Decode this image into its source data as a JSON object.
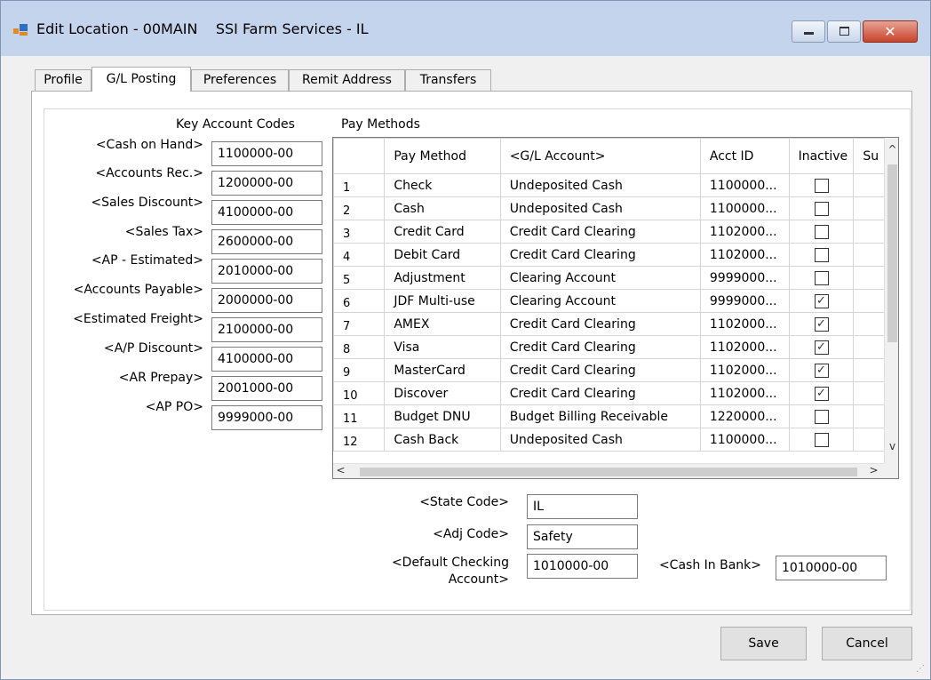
{
  "window": {
    "title": "Edit Location - 00MAIN    SSI Farm Services - IL",
    "minimize_glyph": "▭",
    "maximize_glyph": "▢",
    "close_glyph": "✕"
  },
  "tabs": [
    {
      "label": "Profile",
      "active": false
    },
    {
      "label": "G/L Posting",
      "active": true
    },
    {
      "label": "Preferences",
      "active": false
    },
    {
      "label": "Remit Address",
      "active": false
    },
    {
      "label": "Transfers",
      "active": false
    }
  ],
  "key_accounts": {
    "heading": "Key Account Codes",
    "fields": [
      {
        "label": "<Cash on Hand>",
        "value": "1100000-00"
      },
      {
        "label": "<Accounts Rec.>",
        "value": "1200000-00"
      },
      {
        "label": "<Sales Discount>",
        "value": "4100000-00"
      },
      {
        "label": "<Sales Tax>",
        "value": "2600000-00"
      },
      {
        "label": "<AP - Estimated>",
        "value": "2010000-00"
      },
      {
        "label": "<Accounts Payable>",
        "value": "2000000-00"
      },
      {
        "label": "<Estimated Freight>",
        "value": "2100000-00"
      },
      {
        "label": "<A/P Discount>",
        "value": "4100000-00"
      },
      {
        "label": "<AR Prepay>",
        "value": "2001000-00"
      },
      {
        "label": "<AP PO>",
        "value": "9999000-00"
      }
    ]
  },
  "pay_methods": {
    "heading": "Pay Methods",
    "columns": [
      "",
      "Pay Method",
      "<G/L Account>",
      "Acct ID",
      "Inactive",
      "Su"
    ],
    "rows": [
      {
        "num": "1",
        "method": "Check",
        "account": "Undeposited Cash",
        "acct_id": "1100000...",
        "inactive": false
      },
      {
        "num": "2",
        "method": "Cash",
        "account": "Undeposited Cash",
        "acct_id": "1100000...",
        "inactive": false
      },
      {
        "num": "3",
        "method": "Credit Card",
        "account": "Credit Card Clearing",
        "acct_id": "1102000...",
        "inactive": false
      },
      {
        "num": "4",
        "method": "Debit Card",
        "account": "Credit Card Clearing",
        "acct_id": "1102000...",
        "inactive": false
      },
      {
        "num": "5",
        "method": "Adjustment",
        "account": "Clearing Account",
        "acct_id": "9999000...",
        "inactive": false
      },
      {
        "num": "6",
        "method": "JDF Multi-use",
        "account": "Clearing Account",
        "acct_id": "9999000...",
        "inactive": true
      },
      {
        "num": "7",
        "method": "AMEX",
        "account": "Credit Card Clearing",
        "acct_id": "1102000...",
        "inactive": true
      },
      {
        "num": "8",
        "method": "Visa",
        "account": "Credit Card Clearing",
        "acct_id": "1102000...",
        "inactive": true
      },
      {
        "num": "9",
        "method": "MasterCard",
        "account": "Credit Card Clearing",
        "acct_id": "1102000...",
        "inactive": true
      },
      {
        "num": "10",
        "method": "Discover",
        "account": "Credit Card Clearing",
        "acct_id": "1102000...",
        "inactive": true
      },
      {
        "num": "11",
        "method": "Budget DNU",
        "account": "Budget Billing Receivable",
        "acct_id": "1220000...",
        "inactive": false
      },
      {
        "num": "12",
        "method": "Cash Back",
        "account": "Undeposited Cash",
        "acct_id": "1100000...",
        "inactive": false
      }
    ],
    "check_glyph": "✓",
    "scroll_up": "^",
    "scroll_down": "v",
    "scroll_left": "<",
    "scroll_right": ">"
  },
  "bottom_fields": {
    "state_code": {
      "label": "<State Code>",
      "value": "IL"
    },
    "adj_code": {
      "label": "<Adj Code>",
      "value": "Safety"
    },
    "default_checking": {
      "label_line1": "<Default Checking",
      "label_line2": "Account>",
      "value": "1010000-00"
    },
    "cash_in_bank": {
      "label": "<Cash In Bank>",
      "value": "1010000-00"
    }
  },
  "buttons": {
    "save": "Save",
    "cancel": "Cancel"
  },
  "colors": {
    "titlebar": "#c4d4ec",
    "close_button": "#c7432b"
  }
}
